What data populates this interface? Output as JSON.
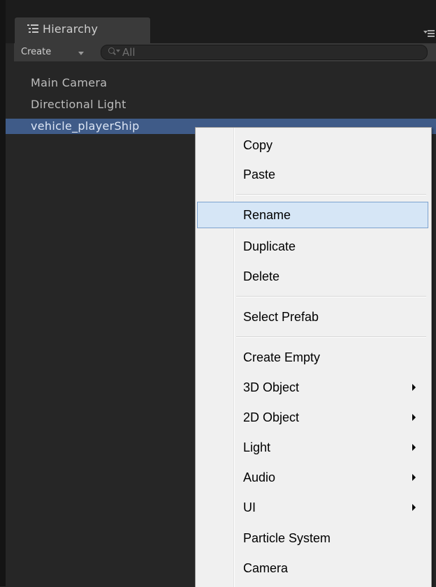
{
  "tab": {
    "title": "Hierarchy",
    "icon": "list-icon"
  },
  "toolbar": {
    "create_label": "Create",
    "search_placeholder": "All"
  },
  "hierarchy": {
    "items": [
      {
        "label": "Main Camera",
        "selected": false
      },
      {
        "label": "Directional Light",
        "selected": false
      },
      {
        "label": "vehicle_playerShip",
        "selected": true
      }
    ]
  },
  "context_menu": {
    "items": [
      {
        "label": "Copy",
        "submenu": false,
        "highlighted": false
      },
      {
        "label": "Paste",
        "submenu": false,
        "highlighted": false
      },
      {
        "label": "Rename",
        "submenu": false,
        "highlighted": true
      },
      {
        "label": "Duplicate",
        "submenu": false,
        "highlighted": false
      },
      {
        "label": "Delete",
        "submenu": false,
        "highlighted": false
      },
      {
        "label": "Select Prefab",
        "submenu": false,
        "highlighted": false
      },
      {
        "label": "Create Empty",
        "submenu": false,
        "highlighted": false
      },
      {
        "label": "3D Object",
        "submenu": true,
        "highlighted": false
      },
      {
        "label": "2D Object",
        "submenu": true,
        "highlighted": false
      },
      {
        "label": "Light",
        "submenu": true,
        "highlighted": false
      },
      {
        "label": "Audio",
        "submenu": true,
        "highlighted": false
      },
      {
        "label": "UI",
        "submenu": true,
        "highlighted": false
      },
      {
        "label": "Particle System",
        "submenu": false,
        "highlighted": false
      },
      {
        "label": "Camera",
        "submenu": false,
        "highlighted": false
      }
    ]
  },
  "colors": {
    "selection": "#3f5b88",
    "menu_background": "#f0f0f0",
    "menu_highlight": "#d6e6f6",
    "panel_background": "#262626"
  }
}
